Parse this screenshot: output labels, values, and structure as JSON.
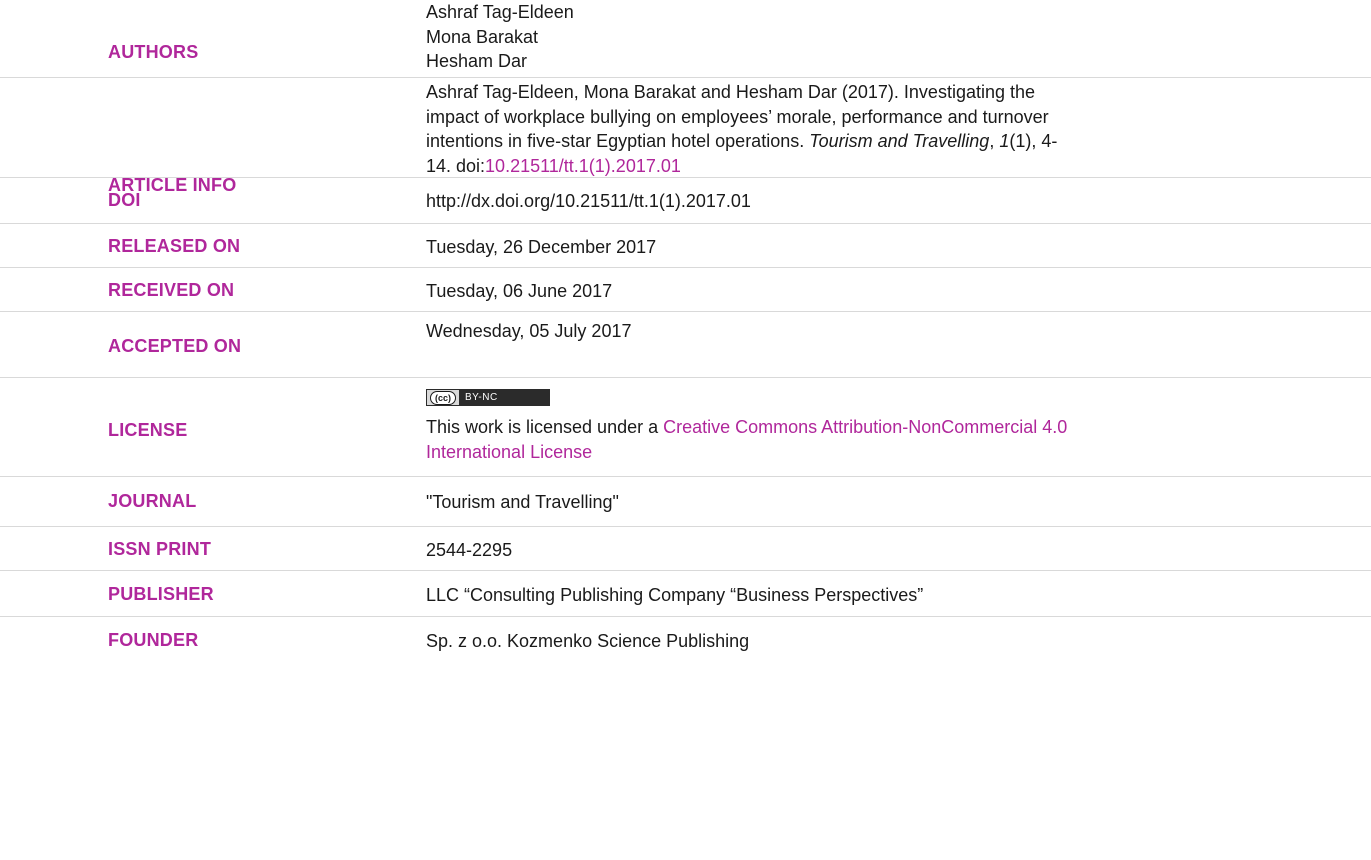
{
  "rows": {
    "authors": {
      "label": "AUTHORS",
      "names": [
        "Ashraf Tag-Eldeen",
        "Mona Barakat",
        "Hesham Dar"
      ]
    },
    "article_info": {
      "label": "ARTICLE INFO",
      "citation_part1": "Ashraf Tag-Eldeen, Mona Barakat and Hesham Dar (2017). Investigating the",
      "citation_part2": "impact of workplace bullying on employees’ morale, performance and turnover",
      "citation_part3": "intentions in five-star Egyptian hotel operations. ",
      "journal_italic": "Tourism and Travelling",
      "sep1": ", ",
      "volume_italic": "1",
      "issue_pages": "(1), 4-",
      "pages_end": "14. doi:",
      "doi_link": "10.21511/tt.1(1).2017.01"
    },
    "doi": {
      "label": "DOI",
      "value": "http://dx.doi.org/10.21511/tt.1(1).2017.01"
    },
    "released_on": {
      "label": "RELEASED ON",
      "value": "Tuesday, 26 December 2017"
    },
    "received_on": {
      "label": "RECEIVED ON",
      "value": "Tuesday, 06 June 2017"
    },
    "accepted_on": {
      "label": "ACCEPTED ON",
      "value": "Wednesday, 05 July 2017"
    },
    "license": {
      "label": "LICENSE",
      "badge_cc": "(cc)",
      "badge_text": "BY-NC",
      "text_prefix": "This work is licensed under a ",
      "link_line1": "Creative Commons Attribution-NonCommercial 4.0",
      "link_line2": "International License"
    },
    "journal": {
      "label": "JOURNAL",
      "value": "\"Tourism and Travelling\""
    },
    "issn_print": {
      "label": "ISSN PRINT",
      "value": "2544-2295"
    },
    "publisher": {
      "label": "PUBLISHER",
      "value": "LLC “Consulting Publishing Company “Business Perspectives”"
    },
    "founder": {
      "label": "FOUNDER",
      "value": "Sp. z o.o. Kozmenko Science Publishing"
    }
  },
  "colors": {
    "label": "#b0279b",
    "link": "#b0279b",
    "text": "#1a1a1a",
    "divider": "#d9d9d9"
  }
}
